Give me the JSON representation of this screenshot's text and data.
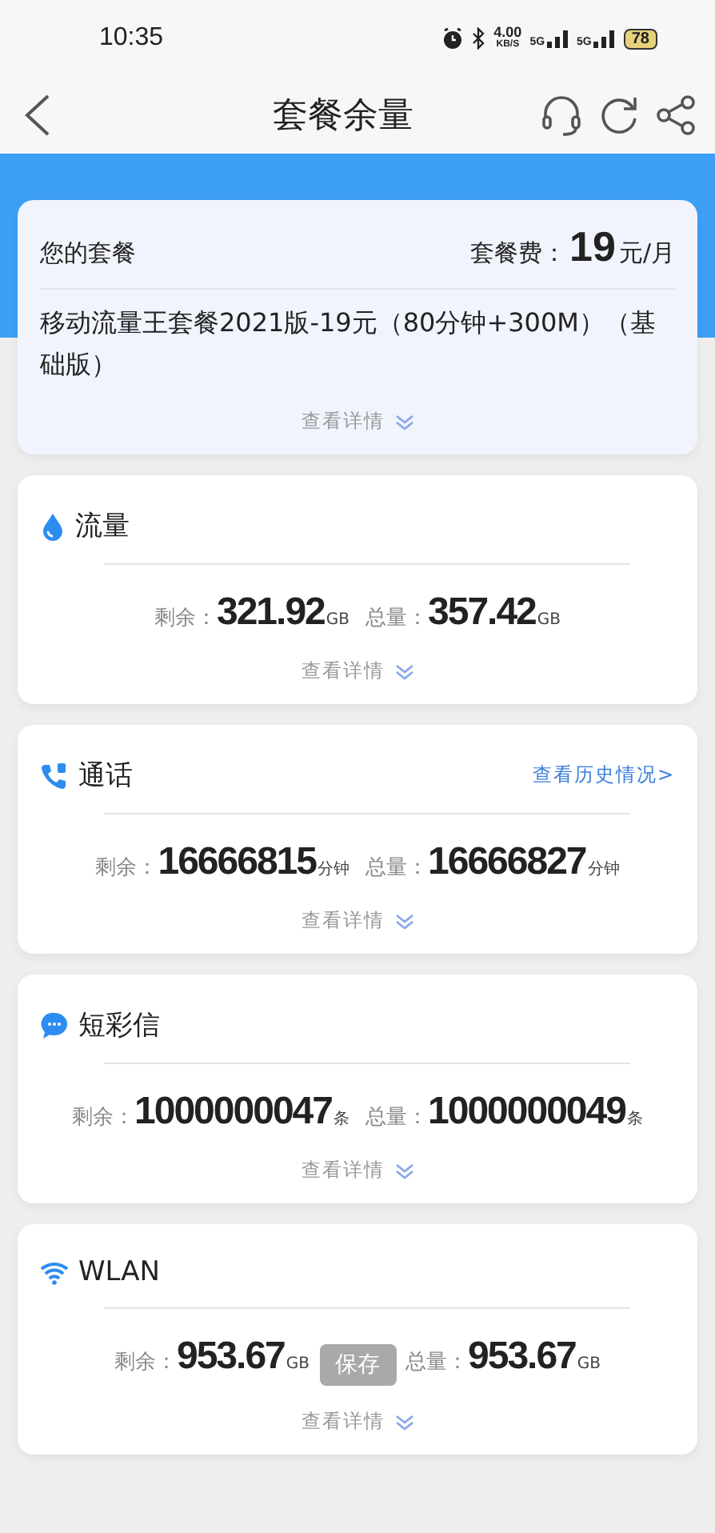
{
  "status_bar": {
    "time": "10:35",
    "speed": "4.00",
    "speed_unit": "KB/S",
    "networks": [
      "5G",
      "5G"
    ],
    "battery": "78"
  },
  "nav_bar": {
    "title": "套餐余量"
  },
  "plan": {
    "label": "您的套餐",
    "fee_label": "套餐费：",
    "fee": "19",
    "fee_unit": "元/月",
    "name": "移动流量王套餐2021版-19元（80分钟+300M）（基础版）",
    "details": "查看详情"
  },
  "usage": [
    {
      "kind": "data",
      "title": "流量",
      "remaining_label": "剩余：",
      "remaining": "321.92",
      "remaining_unit": "GB",
      "total_label": "总量：",
      "total": "357.42",
      "total_unit": "GB",
      "details": "查看详情"
    },
    {
      "kind": "call",
      "title": "通话",
      "link": "查看历史情况>",
      "remaining_label": "剩余：",
      "remaining": "16666815",
      "remaining_unit": "分钟",
      "total_label": "总量：",
      "total": "16666827",
      "total_unit": "分钟",
      "details": "查看详情"
    },
    {
      "kind": "sms",
      "title": "短彩信",
      "remaining_label": "剩余：",
      "remaining": "1000000047",
      "remaining_unit": "条",
      "total_label": "总量：",
      "total": "1000000049",
      "total_unit": "条",
      "details": "查看详情"
    },
    {
      "kind": "wlan",
      "title": "WLAN",
      "remaining_label": "剩余：",
      "remaining": "953.67",
      "remaining_unit": "GB",
      "total_label": "总量：",
      "total": "953.67",
      "total_unit": "GB",
      "details": "查看详情"
    }
  ],
  "overlay_button": "保存"
}
